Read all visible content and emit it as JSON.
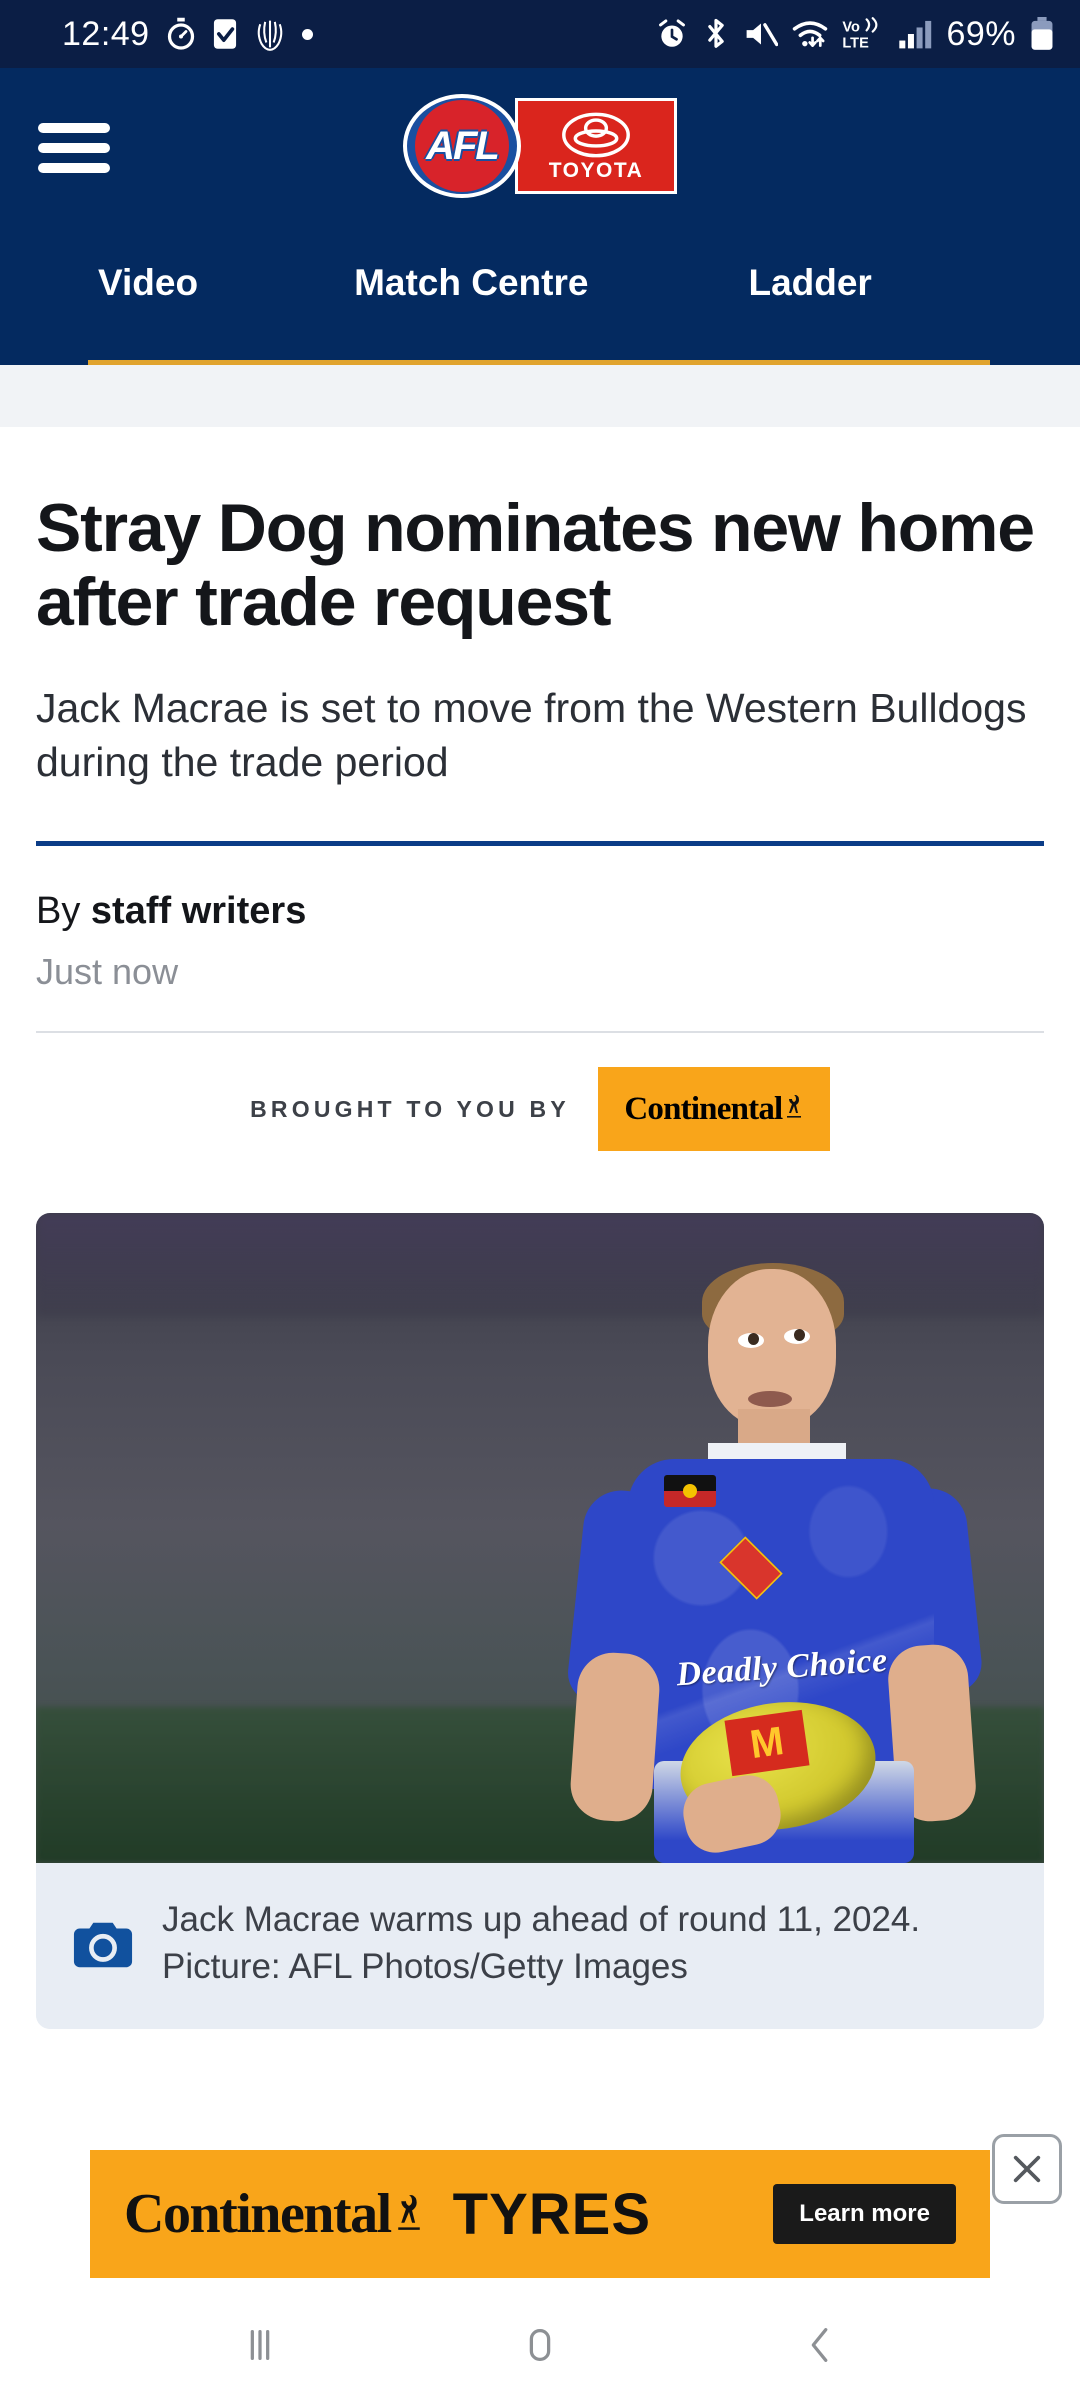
{
  "status_bar": {
    "time": "12:49",
    "battery_percent": "69%",
    "left_icons": [
      "stopwatch-icon",
      "checkbox-icon",
      "mcc-monogram-icon",
      "dot-icon"
    ],
    "right_icons": [
      "alarm-icon",
      "bluetooth-icon",
      "mute-icon",
      "wifi-icon",
      "volte-icon",
      "signal-icon",
      "battery-icon"
    ],
    "volte_label": "Vo)) LTE",
    "background": "#0b1e45"
  },
  "header": {
    "menu_label": "menu",
    "logo_primary": "AFL",
    "logo_sponsor": "TOYOTA",
    "background": "#042a60",
    "accent": "#e0a32e",
    "tabs": [
      {
        "label": "Video"
      },
      {
        "label": "Match Centre"
      },
      {
        "label": "Ladder"
      }
    ]
  },
  "article": {
    "headline": "Stray Dog nominates new home after trade request",
    "standfirst": "Jack Macrae is set to move from the Western Bulldogs during the trade period",
    "byline_prefix": "By",
    "byline_author": "staff writers",
    "timestamp": "Just now",
    "rule_color": "#0b3c87"
  },
  "sponsor": {
    "label": "BROUGHT TO YOU BY",
    "brand": "Continental",
    "brand_bg": "#f9a51a"
  },
  "figure": {
    "caption": "Jack Macrae warms up ahead of round 11, 2024. Picture: AFL Photos/Getty Images",
    "caption_icon": "camera-icon",
    "jersey_text": "Deadly Choice",
    "ball_brand": "M",
    "caption_bg": "#e8edf4"
  },
  "ad": {
    "brand": "Continental",
    "product": "TYRES",
    "cta": "Learn more",
    "close_label": "✕",
    "background": "#f9a51a"
  },
  "system_nav": {
    "recents": "recents-icon",
    "home": "home-icon",
    "back": "back-icon"
  }
}
